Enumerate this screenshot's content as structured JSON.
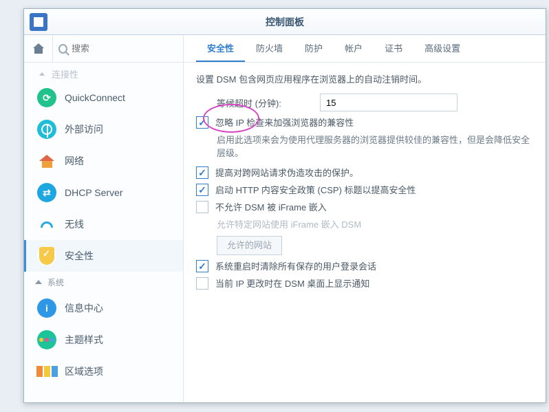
{
  "title": "控制面板",
  "search": {
    "placeholder": "搜索"
  },
  "sidebar": {
    "cut_label": "连接性",
    "items": [
      {
        "label": "QuickConnect"
      },
      {
        "label": "外部访问"
      },
      {
        "label": "网络"
      },
      {
        "label": "DHCP Server"
      },
      {
        "label": "无线"
      },
      {
        "label": "安全性"
      }
    ],
    "group2_label": "系统",
    "items2": [
      {
        "label": "信息中心"
      },
      {
        "label": "主题样式"
      },
      {
        "label": "区域选项"
      }
    ]
  },
  "tabs": [
    {
      "label": "安全性"
    },
    {
      "label": "防火墙"
    },
    {
      "label": "防护"
    },
    {
      "label": "帐户"
    },
    {
      "label": "证书"
    },
    {
      "label": "高级设置"
    }
  ],
  "panel": {
    "description": "设置 DSM 包含网页应用程序在浏览器上的自动注销时间。",
    "timeout_label": "等候超时 (分钟):",
    "timeout_value": "15",
    "opt_ignore_ip": "忽略 IP 检查来加强浏览器的兼容性",
    "opt_ignore_ip_help": "启用此选项来会为使用代理服务器的浏览器提供较佳的兼容性，但是会降低安全层级。",
    "opt_csrf": "提高对跨网站请求伪造攻击的保护。",
    "opt_csp": "启动 HTTP 内容安全政策 (CSP) 标题以提高安全性",
    "opt_iframe": "不允许 DSM 被 iFrame 嵌入",
    "opt_iframe_allow_label": "允许特定网站使用 iFrame 嵌入 DSM",
    "btn_allowed_sites": "允许的网站",
    "opt_clear_sessions": "系统重启时清除所有保存的用户登录会话",
    "opt_ip_change_notify": "当前 IP 更改时在 DSM 桌面上显示通知"
  }
}
